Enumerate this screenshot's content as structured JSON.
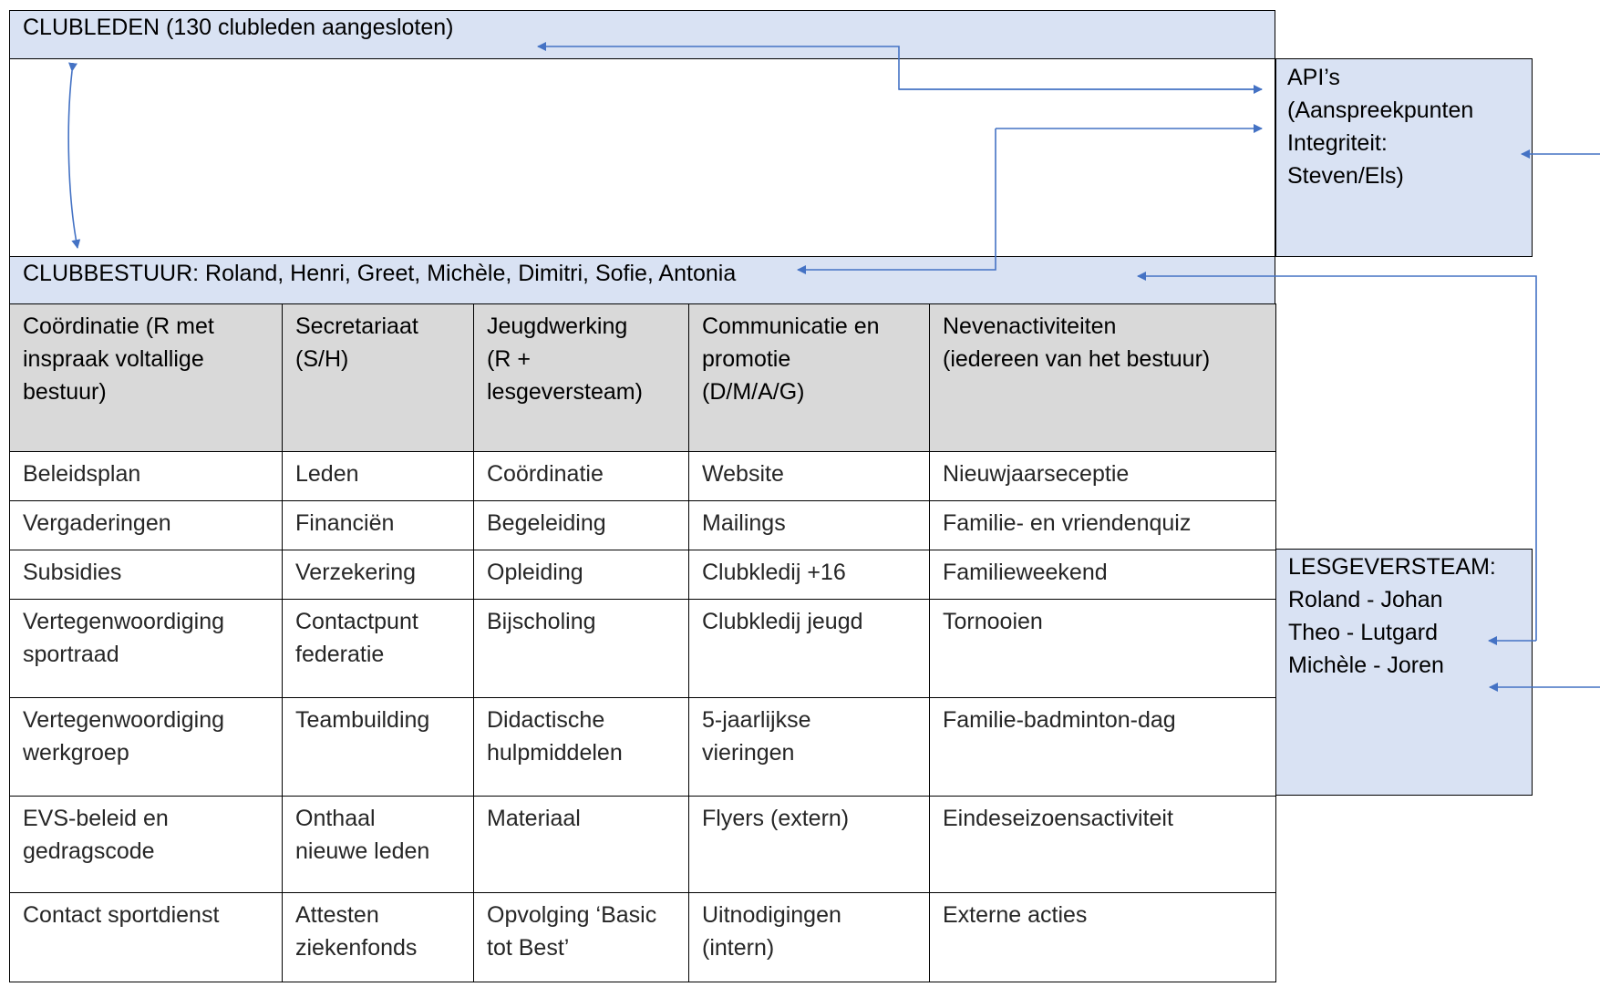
{
  "clubleden": {
    "label": "CLUBLEDEN (130 clubleden aangesloten)"
  },
  "clubbestuur": {
    "label": "CLUBBESTUUR: Roland, Henri, Greet, Michèle, Dimitri, Sofie, Antonia"
  },
  "apis": {
    "lines": [
      "API’s",
      "(Aanspreekpunten",
      "Integriteit:",
      "Steven/Els)"
    ]
  },
  "lesgeversteam": {
    "lines": [
      "LESGEVERSTEAM:",
      "Roland  - Johan",
      "Theo - Lutgard",
      "Michèle - Joren"
    ]
  },
  "table": {
    "headers": [
      [
        "Coördinatie (R met",
        "inspraak voltallige",
        "bestuur)"
      ],
      [
        "Secretariaat",
        "(S/H)"
      ],
      [
        "Jeugdwerking",
        "(R +",
        "lesgeversteam)"
      ],
      [
        "Communicatie en",
        "promotie",
        "(D/M/A/G)"
      ],
      [
        "Nevenactiviteiten",
        "(iedereen van het bestuur)"
      ]
    ],
    "rows": [
      [
        [
          "Beleidsplan"
        ],
        [
          "Leden"
        ],
        [
          "Coördinatie"
        ],
        [
          "Website"
        ],
        [
          "Nieuwjaarseceptie"
        ]
      ],
      [
        [
          "Vergaderingen"
        ],
        [
          "Financiën"
        ],
        [
          "Begeleiding"
        ],
        [
          "Mailings"
        ],
        [
          "Familie- en vriendenquiz"
        ]
      ],
      [
        [
          "Subsidies"
        ],
        [
          "Verzekering"
        ],
        [
          "Opleiding"
        ],
        [
          "Clubkledij +16"
        ],
        [
          "Familieweekend"
        ]
      ],
      [
        [
          "Vertegenwoordiging",
          "sportraad"
        ],
        [
          "Contactpunt",
          "federatie"
        ],
        [
          "Bijscholing"
        ],
        [
          "Clubkledij jeugd"
        ],
        [
          "Tornooien"
        ]
      ],
      [
        [
          "Vertegenwoordiging",
          "werkgroep"
        ],
        [
          "Teambuilding"
        ],
        [
          "Didactische",
          "hulpmiddelen"
        ],
        [
          "5-jaarlijkse",
          "vieringen"
        ],
        [
          "Familie-badminton-dag"
        ]
      ],
      [
        [
          "EVS-beleid en",
          "gedragscode"
        ],
        [
          "Onthaal",
          "nieuwe leden"
        ],
        [
          "Materiaal"
        ],
        [
          "Flyers (extern)"
        ],
        [
          "Eindeseizoensactiviteit"
        ]
      ],
      [
        [
          "Contact sportdienst"
        ],
        [
          "Attesten",
          "ziekenfonds"
        ],
        [
          "Opvolging ‘Basic",
          "tot Best’"
        ],
        [
          "Uitnodigingen",
          "(intern)"
        ],
        [
          "Externe acties"
        ]
      ]
    ]
  },
  "colors": {
    "box_fill": "#d9e2f3",
    "header_fill": "#d9d9d9",
    "arrow": "#4472c4",
    "border": "#000000"
  }
}
